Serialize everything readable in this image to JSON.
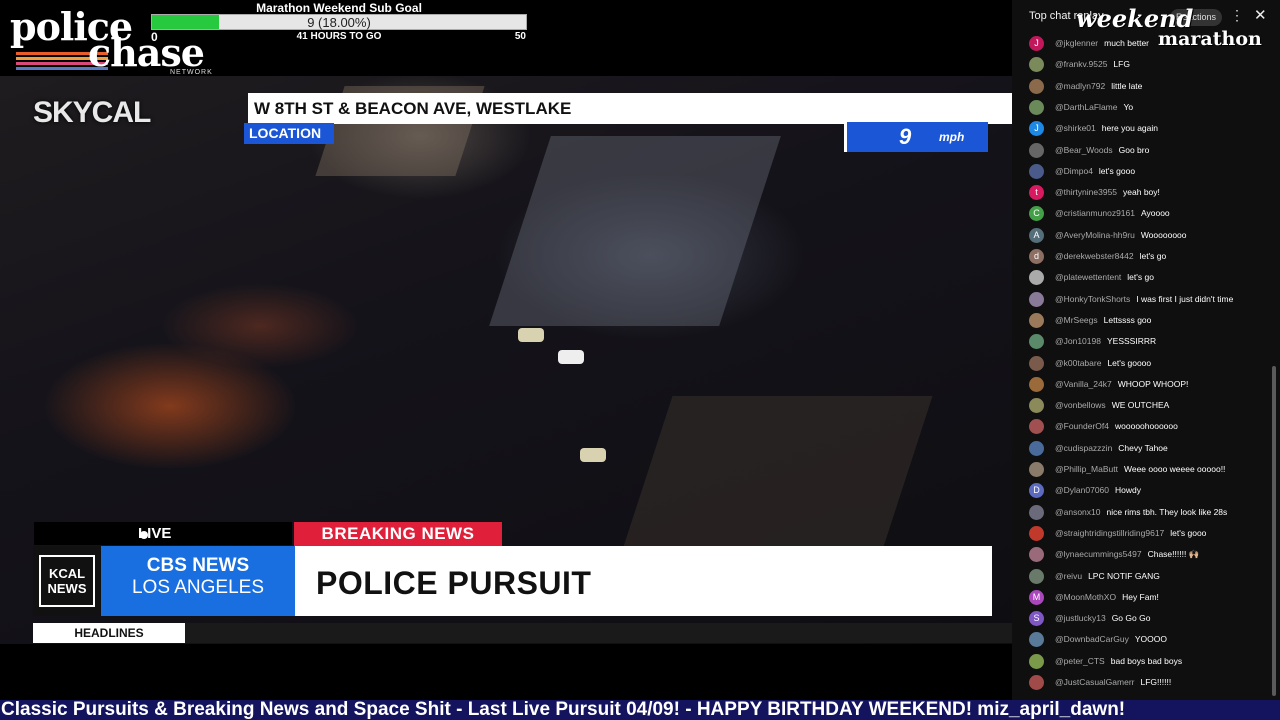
{
  "logo": {
    "line1": "police",
    "line2": "chase",
    "network": "NETWORK"
  },
  "goal": {
    "title": "Marathon Weekend Sub Goal",
    "progress_text": "9 (18.00%)",
    "progress_fraction": 0.18,
    "min": "0",
    "time_left": "41 HOURS TO GO",
    "max": "50"
  },
  "video": {
    "brand": "SKYCAL",
    "location": "W 8TH ST & BEACON AVE, WESTLAKE",
    "location_tag": "LOCATION",
    "speed_value": "9",
    "speed_unit": "mph",
    "live": "LIVE",
    "breaking": "BREAKING NEWS",
    "kcal": "KCAL NEWS",
    "cbs_line1": "CBS NEWS",
    "cbs_line2": "LOS ANGELES",
    "headline": "POLICE PURSUIT",
    "headlines_tag": "HEADLINES"
  },
  "chat": {
    "title": "Top chat replay",
    "pill": "Reactions",
    "watermark1": "weekend",
    "watermark2": "marathon",
    "messages": [
      {
        "user": "@jkglenner",
        "text": "much better",
        "initial": "J",
        "color": "#c2185b"
      },
      {
        "user": "@frankv.9525",
        "text": "LFG",
        "initial": "",
        "color": "#7b8a5a"
      },
      {
        "user": "@madlyn792",
        "text": "little late",
        "initial": "",
        "color": "#8a6a4a"
      },
      {
        "user": "@DarthLaFlame",
        "text": "Yo",
        "initial": "",
        "color": "#6a8a5a"
      },
      {
        "user": "@shirke01",
        "text": "here you again",
        "initial": "J",
        "color": "#1e88e5"
      },
      {
        "user": "@Bear_Woods",
        "text": "Goo bro",
        "initial": "",
        "color": "#666"
      },
      {
        "user": "@Dimpo4",
        "text": "let's gooo",
        "initial": "",
        "color": "#4a5a8a"
      },
      {
        "user": "@thirtynine3955",
        "text": "yeah boy!",
        "initial": "t",
        "color": "#d81b60"
      },
      {
        "user": "@cristianmunoz9161",
        "text": "Ayoooo",
        "initial": "C",
        "color": "#43a047"
      },
      {
        "user": "@AveryMolina-hh9ru",
        "text": "Woooooooo",
        "initial": "A",
        "color": "#546e7a"
      },
      {
        "user": "@derekwebster8442",
        "text": "let's go",
        "initial": "d",
        "color": "#8d6e63"
      },
      {
        "user": "@platewettentent",
        "text": "let's go",
        "initial": "",
        "color": "#aaa"
      },
      {
        "user": "@HonkyTonkShorts",
        "text": "I was first I just didn't time",
        "initial": "",
        "color": "#8a7a9a"
      },
      {
        "user": "@MrSeegs",
        "text": "Lettssss goo",
        "initial": "",
        "color": "#9a7a5a"
      },
      {
        "user": "@Jon10198",
        "text": "YESSSIRRR",
        "initial": "",
        "color": "#5a8a6a"
      },
      {
        "user": "@k00tabare",
        "text": "Let's goooo",
        "initial": "",
        "color": "#7a5a4a"
      },
      {
        "user": "@Vanilla_24k7",
        "text": "WHOOP WHOOP!",
        "initial": "",
        "color": "#9a6a3a"
      },
      {
        "user": "@vonbellows",
        "text": "WE OUTCHEA",
        "initial": "",
        "color": "#8a8a5a"
      },
      {
        "user": "@FounderOf4",
        "text": "wooooohoooooo",
        "initial": "",
        "color": "#a05050"
      },
      {
        "user": "@cudispazzzin",
        "text": "Chevy Tahoe",
        "initial": "",
        "color": "#4a6a9a"
      },
      {
        "user": "@Phillip_MaButt",
        "text": "Weee oooo weeee ooooo!!",
        "initial": "",
        "color": "#8a7a6a"
      },
      {
        "user": "@Dylan07060",
        "text": "Howdy",
        "initial": "D",
        "color": "#5c6bc0"
      },
      {
        "user": "@ansonx10",
        "text": "nice rims tbh. They look like 28s",
        "initial": "",
        "color": "#6a6a7a"
      },
      {
        "user": "@straightridingstillriding9617",
        "text": "let's gooo",
        "initial": "",
        "color": "#c0392b"
      },
      {
        "user": "@lynaecummings5497",
        "text": "Chase!!!!!! 🙌🏼",
        "initial": "",
        "color": "#9a6a7a"
      },
      {
        "user": "@reivu",
        "text": "LPC NOTIF GANG",
        "initial": "",
        "color": "#6a7a6a"
      },
      {
        "user": "@MoonMothXO",
        "text": "Hey Fam!",
        "initial": "M",
        "color": "#ab47bc"
      },
      {
        "user": "@justlucky13",
        "text": "Go Go Go",
        "initial": "S",
        "color": "#7e57c2"
      },
      {
        "user": "@DownbadCarGuy",
        "text": "YOOOO",
        "initial": "",
        "color": "#5a7a9a"
      },
      {
        "user": "@peter_CTS",
        "text": "bad boys bad boys",
        "initial": "",
        "color": "#7a9a4a"
      },
      {
        "user": "@JustCasualGamerr",
        "text": "LFG!!!!!!",
        "initial": "",
        "color": "#a04a4a"
      }
    ]
  },
  "marquee": "Classic Pursuits & Breaking News and Space Shit - Last Live Pursuit 04/09! - HAPPY BIRTHDAY WEEKEND! miz_april_dawn!"
}
